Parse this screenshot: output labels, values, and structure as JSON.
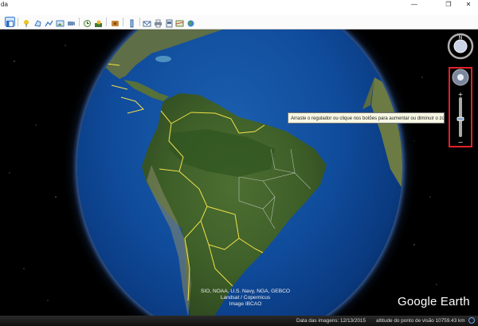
{
  "window": {
    "title_partial": "da",
    "controls": [
      "—",
      "❐",
      "✕"
    ]
  },
  "toolbar": {
    "buttons": [
      "sidebar-toggle",
      "placemark",
      "polygon",
      "path",
      "image-overlay",
      "record-tour",
      "historical-imagery",
      "sunlight",
      "sky",
      "ruler",
      "email",
      "print",
      "save-image",
      "maps",
      "earth-gallery"
    ],
    "active": "sidebar-toggle"
  },
  "navigation": {
    "tooltip": "Arraste o regulador ou clique nos botões para aumentar ou diminuir o zoom",
    "zoom_level": 0.55
  },
  "map": {
    "credits": [
      "SIO, NOAA, U.S. Navy, NGA, GEBCO",
      "Landsat / Copernicus",
      "Image IBCAO"
    ],
    "logo": "Google Earth",
    "border_color": "#f2e24a",
    "ocean_color": "#104c9c"
  },
  "status": {
    "imagery_date": "Data das imagens: 12/13/2015",
    "eye_altitude": "altitude do ponto de visão  10759.43 km"
  }
}
